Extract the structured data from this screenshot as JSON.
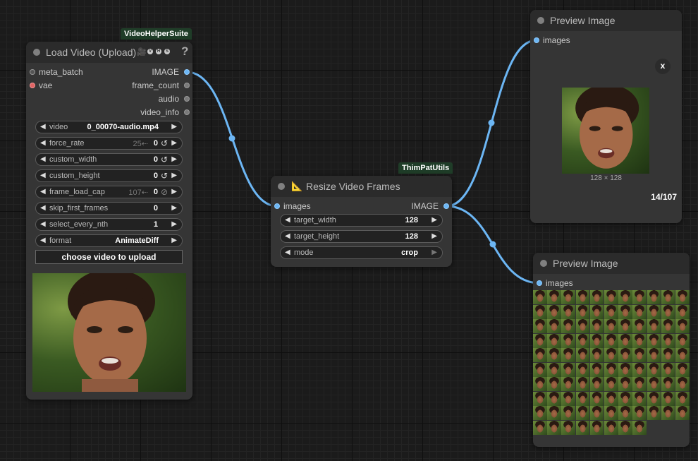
{
  "load_video": {
    "badge": "VideoHelperSuite",
    "title": "Load Video (Upload)",
    "help": "?",
    "emoji": "🎥",
    "vhs_letters": [
      "V",
      "H",
      "S"
    ],
    "inputs": [
      "meta_batch",
      "vae"
    ],
    "outputs": [
      "IMAGE",
      "frame_count",
      "audio",
      "video_info"
    ],
    "widgets": {
      "video": {
        "name": "video",
        "value": "0_00070-audio.mp4"
      },
      "force_rate": {
        "name": "force_rate",
        "value": "0",
        "extra": "25⇠"
      },
      "custom_width": {
        "name": "custom_width",
        "value": "0"
      },
      "custom_height": {
        "name": "custom_height",
        "value": "0"
      },
      "frame_load_cap": {
        "name": "frame_load_cap",
        "value": "0",
        "extra": "107⇠"
      },
      "skip_first_frames": {
        "name": "skip_first_frames",
        "value": "0"
      },
      "select_every_nth": {
        "name": "select_every_nth",
        "value": "1"
      },
      "format": {
        "name": "format",
        "value": "AnimateDiff"
      }
    },
    "upload_button": "choose video to upload"
  },
  "resize": {
    "badge": "ThimPatUtils",
    "title": "Resize Video Frames",
    "input": "images",
    "output": "IMAGE",
    "widgets": {
      "target_width": {
        "name": "target_width",
        "value": "128"
      },
      "target_height": {
        "name": "target_height",
        "value": "128"
      },
      "mode": {
        "name": "mode",
        "value": "crop"
      }
    }
  },
  "preview_top": {
    "title": "Preview Image",
    "input": "images",
    "close": "x",
    "image_size": "128 × 128",
    "counter": "14/107"
  },
  "preview_bottom": {
    "title": "Preview Image",
    "input": "images",
    "grid_count": 107,
    "grid_columns": 11
  },
  "colors": {
    "link": "#6cb6f4",
    "badge_bg": "#1f3d28",
    "node_bg": "#353535",
    "canvas_bg": "#1b1b1b"
  }
}
